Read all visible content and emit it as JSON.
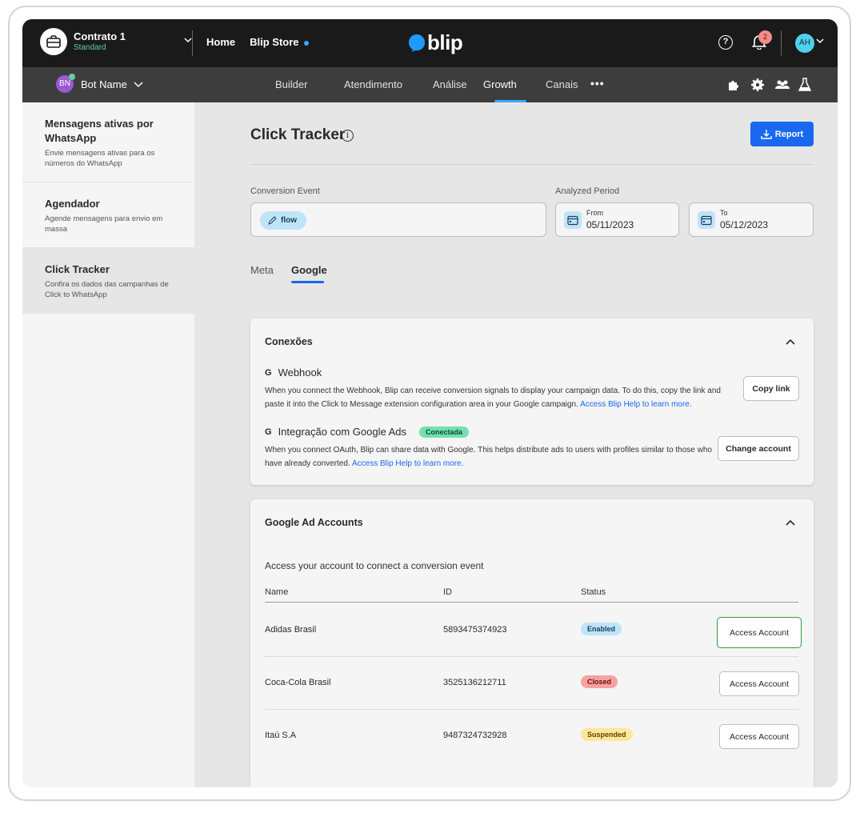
{
  "topbar": {
    "contract_name": "Contrato 1",
    "contract_plan": "Standard",
    "nav_home": "Home",
    "nav_store": "Blip Store",
    "logo_text": "blip",
    "notifications_count": "2",
    "user_initials": "AH"
  },
  "subbar": {
    "bot_initials": "BN",
    "bot_name": "Bot Name",
    "nav": [
      "Builder",
      "Atendimento",
      "Análise",
      "Growth",
      "Canais"
    ],
    "active_nav": "Growth",
    "more": "•••"
  },
  "sidebar": {
    "items": [
      {
        "title": "Mensagens ativas por WhatsApp",
        "desc": "Envie mensagens ativas para os números do WhatsApp"
      },
      {
        "title": "Agendador",
        "desc": "Agende mensagens para envio em massa"
      },
      {
        "title": "Click Tracker",
        "desc": "Confira os dados das campanhas de Click to WhatsApp"
      }
    ]
  },
  "page": {
    "title": "Click Tracker",
    "report_label": "Report",
    "conversion_label": "Conversion Event",
    "conversion_chip": "flow",
    "period_label": "Analyzed Period",
    "from_label": "From",
    "from_value": "05/11/2023",
    "to_label": "To",
    "to_value": "05/12/2023",
    "tabs": [
      "Meta",
      "Google"
    ],
    "active_tab": "Google"
  },
  "connections": {
    "title": "Conexões",
    "webhook_title": "Webhook",
    "webhook_text": "When you connect the Webhook, Blip can receive conversion signals to display your campaign data. To do this, copy the link and paste it into the Click to Message extension configuration area in your Google campaign.",
    "webhook_link": "Access Blip Help to learn more.",
    "copy_link_label": "Copy link",
    "ads_title": "Integração com Google Ads",
    "ads_status": "Conectada",
    "ads_text": "When you connect OAuth, Blip can share data with Google. This helps distribute ads to users with profiles similar to those who have already converted.",
    "ads_link": "Access Blip Help to learn more.",
    "change_account_label": "Change account"
  },
  "accounts": {
    "title": "Google Ad Accounts",
    "description": "Access your account to connect a conversion event",
    "columns": [
      "Name",
      "ID",
      "Status"
    ],
    "access_label": "Access Account",
    "rows": [
      {
        "name": "Adidas Brasil",
        "id": "5893475374923",
        "status": "Enabled",
        "status_bg": "#bfe4f8",
        "status_fg": "#1a3c5e"
      },
      {
        "name": "Coca-Cola Brasil",
        "id": "3525136212711",
        "status": "Closed",
        "status_bg": "#f7a1a1",
        "status_fg": "#6b0a0a"
      },
      {
        "name": "Itaú S.A",
        "id": "9487324732928",
        "status": "Suspended",
        "status_bg": "#fde79a",
        "status_fg": "#5b4500"
      }
    ]
  },
  "colors": {
    "primary": "#1968f0",
    "topbar": "#1a1a1a",
    "subbar": "#3d3d3d"
  }
}
